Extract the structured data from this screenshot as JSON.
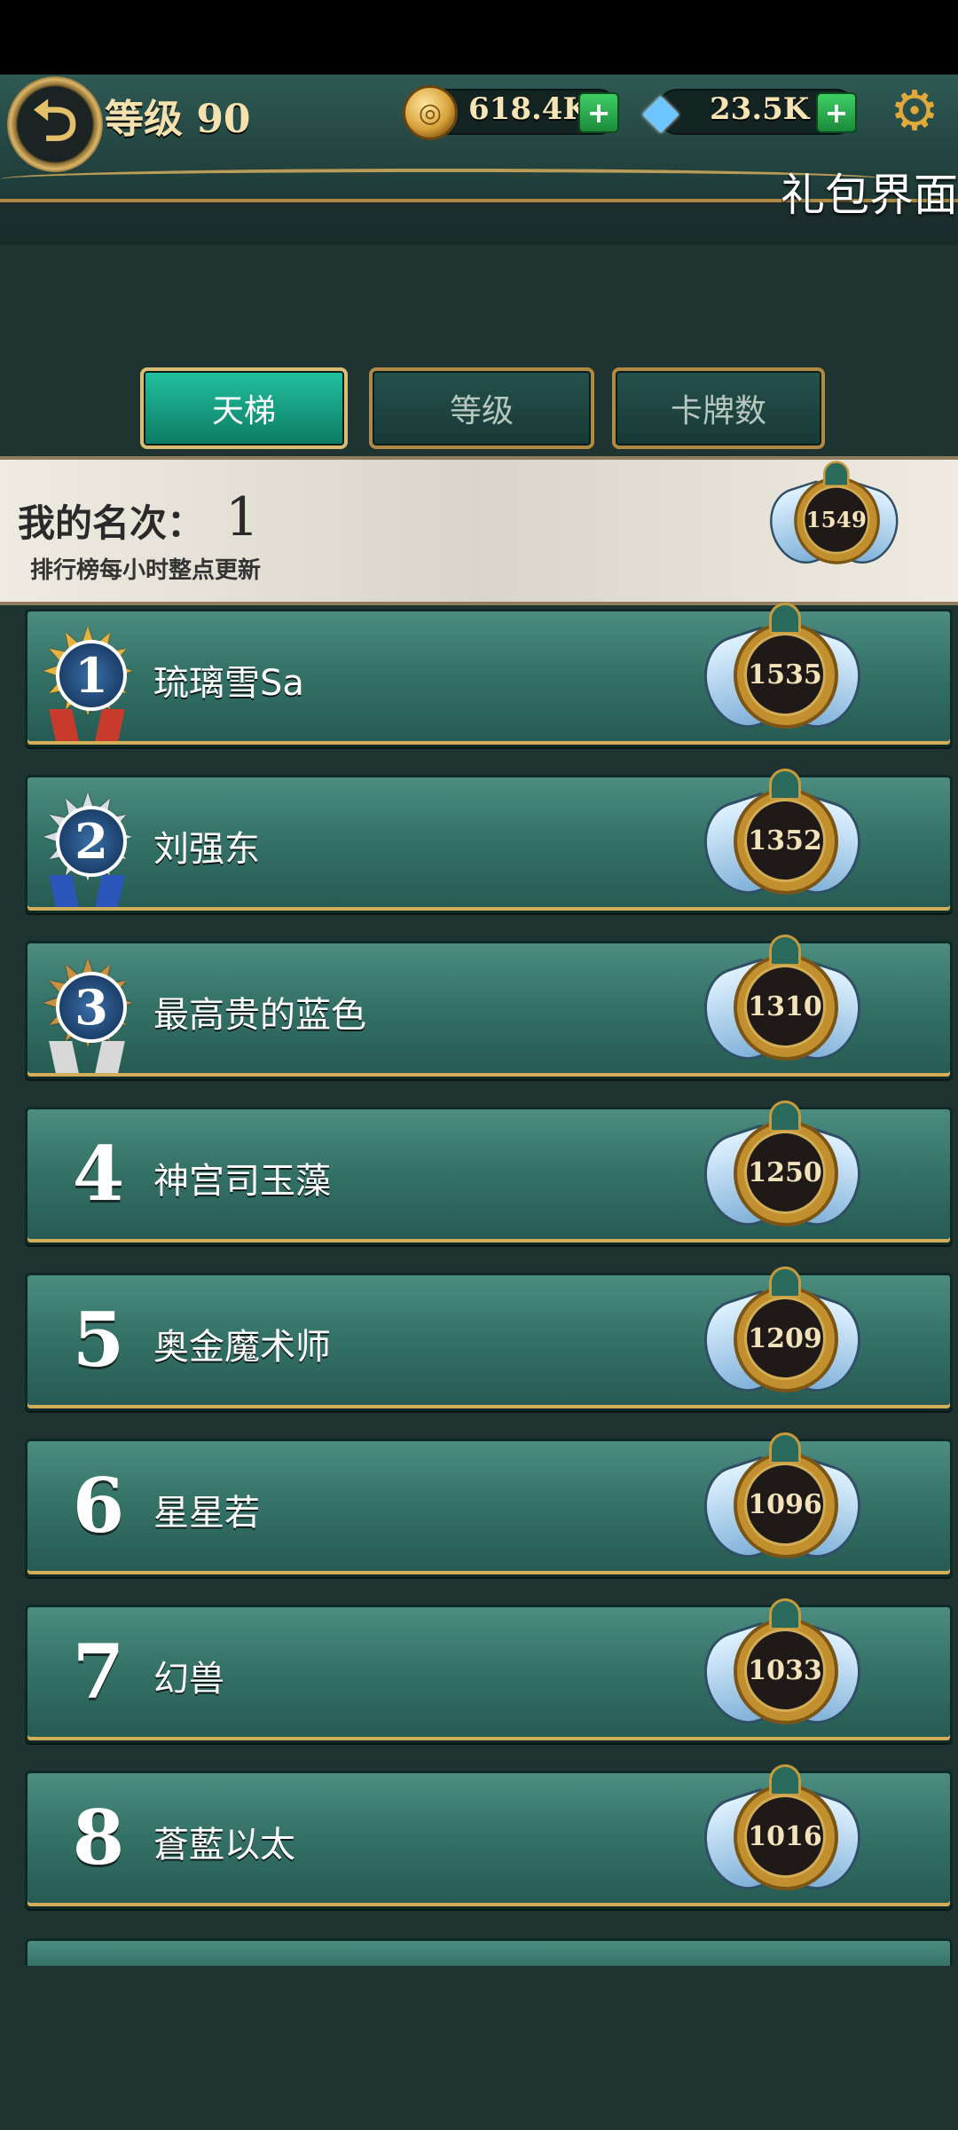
{
  "header": {
    "level_text": "等级 90",
    "coins": "618.4K",
    "gems": "23.5K",
    "plus": "+",
    "screen_title": "礼包界面"
  },
  "tabs": [
    {
      "label": "天梯",
      "active": true
    },
    {
      "label": "等级",
      "active": false
    },
    {
      "label": "卡牌数",
      "active": false
    }
  ],
  "my_rank": {
    "label": "我的名次：",
    "value": "1",
    "note": "排行榜每小时整点更新",
    "score": "1549"
  },
  "leaderboard": [
    {
      "rank": "1",
      "name": "琉璃雪Sa",
      "score": "1535",
      "medal": "gold"
    },
    {
      "rank": "2",
      "name": "刘强东",
      "score": "1352",
      "medal": "silver"
    },
    {
      "rank": "3",
      "name": "最高贵的蓝色",
      "score": "1310",
      "medal": "bronze"
    },
    {
      "rank": "4",
      "name": "神宫司玉藻",
      "score": "1250"
    },
    {
      "rank": "5",
      "name": "奥金魔术师",
      "score": "1209"
    },
    {
      "rank": "6",
      "name": "星星若",
      "score": "1096"
    },
    {
      "rank": "7",
      "name": "幻兽",
      "score": "1033"
    },
    {
      "rank": "8",
      "name": "蒼藍以太",
      "score": "1016"
    }
  ],
  "icons": {
    "back": "back-arrow-icon",
    "coin": "coin-icon",
    "gem": "diamond-icon",
    "settings": "gear-icon"
  },
  "colors": {
    "accent": "#21c2a0",
    "gold": "#c9a65a",
    "row": "#357267"
  }
}
